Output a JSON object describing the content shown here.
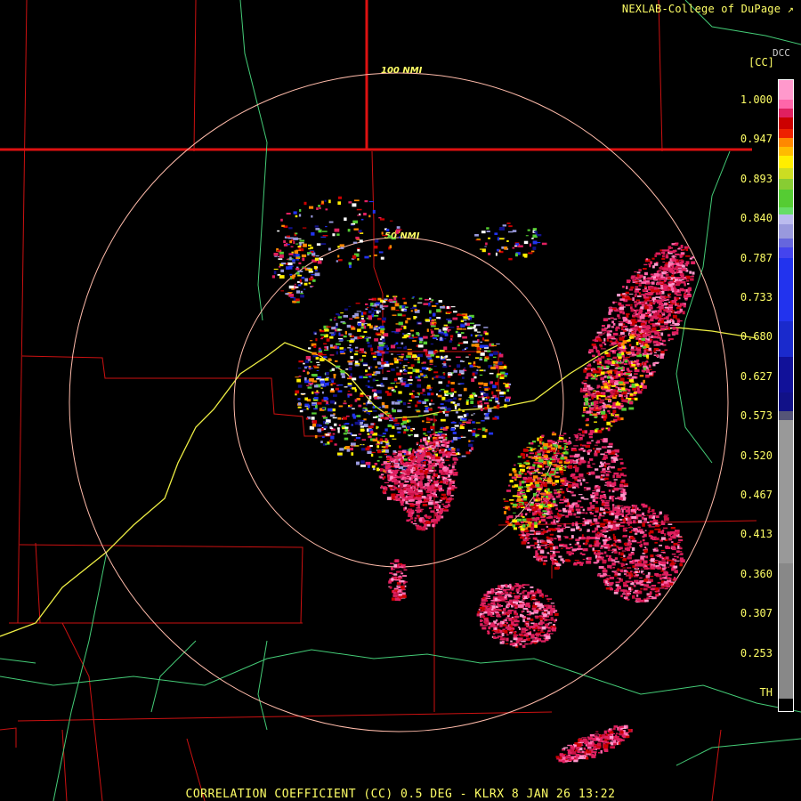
{
  "header": {
    "credit": "NEXLAB-College of DuPage",
    "credit_icon": "external-link-icon",
    "product_code": "[CC]",
    "station_code": "DCC"
  },
  "rings": [
    {
      "label": "50 NMI"
    },
    {
      "label": "100 NMI"
    }
  ],
  "colorbar": {
    "ticks": [
      "1.000",
      "0.947",
      "0.893",
      "0.840",
      "0.787",
      "0.733",
      "0.680",
      "0.627",
      "0.573",
      "0.520",
      "0.467",
      "0.413",
      "0.360",
      "0.307",
      "0.253",
      "TH"
    ],
    "colors": {
      "pink": "#ff99cc",
      "rose": "#e02060",
      "red": "#cc0000",
      "orange": "#ff8800",
      "yellow": "#ffee00",
      "green": "#55cc33",
      "lavender": "#9999dd",
      "blue": "#2233ee",
      "navy": "#111188",
      "gray": "#888888",
      "black": "#000000"
    }
  },
  "footer": {
    "title": "CORRELATION COEFFICIENT (CC) 0.5 DEG - KLRX 8 JAN 26 13:22"
  },
  "map_colors": {
    "county_lines": "#cc1111",
    "state_lines": "#dd1111",
    "rivers": "#44cc77",
    "highway": "#eeee44",
    "range_rings": "#ffbbaa"
  }
}
